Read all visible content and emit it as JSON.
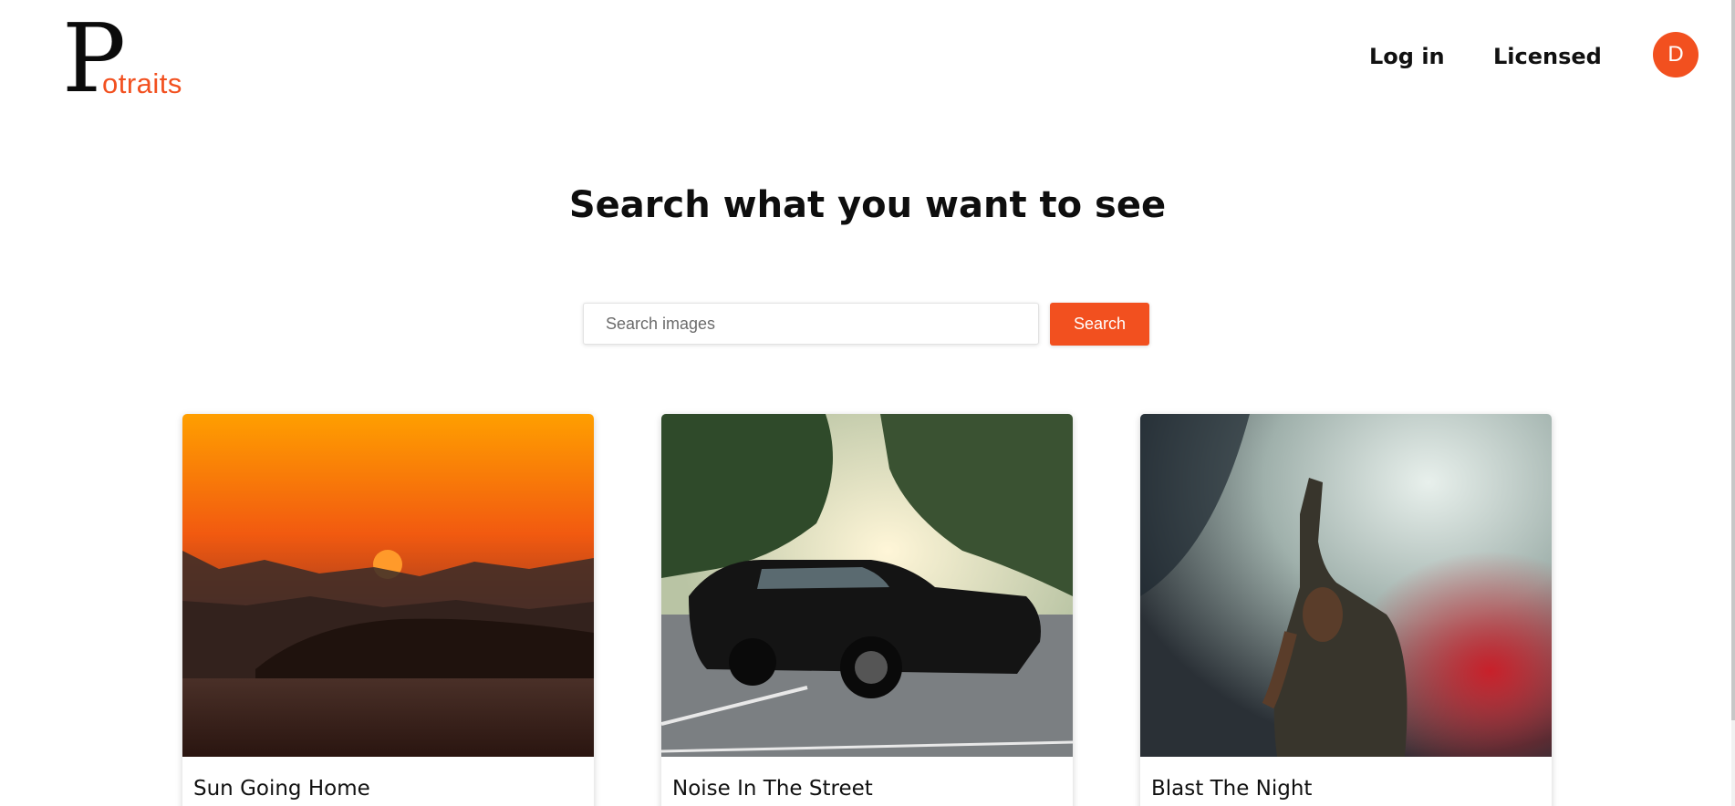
{
  "header": {
    "logo": {
      "initial": "P",
      "rest": "otraits"
    },
    "nav": {
      "login": "Log in",
      "licensed": "Licensed"
    },
    "avatar_initial": "D"
  },
  "hero": {
    "title": "Search what you want to see",
    "search": {
      "placeholder": "Search images",
      "value": "",
      "button_label": "Search"
    }
  },
  "cards": [
    {
      "title": "Sun Going Home"
    },
    {
      "title": "Noise In The Street"
    },
    {
      "title": "Blast The Night"
    }
  ],
  "colors": {
    "accent": "#f2501f",
    "text": "#111111",
    "background": "#ffffff"
  }
}
